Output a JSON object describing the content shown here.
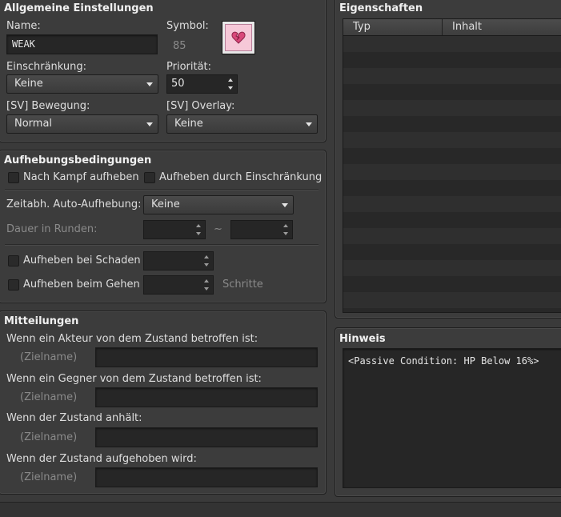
{
  "general": {
    "title": "Allgemeine Einstellungen",
    "name_label": "Name:",
    "name_value": "WEAK",
    "symbol_label": "Symbol:",
    "symbol_index": "85",
    "restriction_label": "Einschränkung:",
    "restriction_value": "Keine",
    "priority_label": "Priorität:",
    "priority_value": "50",
    "sv_motion_label": "[SV] Bewegung:",
    "sv_motion_value": "Normal",
    "sv_overlay_label": "[SV] Overlay:",
    "sv_overlay_value": "Keine",
    "icon_name": "broken-heart-icon",
    "icon_color": "#d9487a"
  },
  "removal": {
    "title": "Aufhebungsbedingungen",
    "remove_after_battle": "Nach Kampf aufheben",
    "remove_by_restriction": "Aufheben durch Einschränkung",
    "auto_removal_label": "Zeitabh. Auto-Aufhebung:",
    "auto_removal_value": "Keine",
    "duration_label": "Dauer in Runden:",
    "duration_sep": "~",
    "remove_by_damage": "Aufheben bei Schaden",
    "remove_by_walking": "Aufheben beim Gehen",
    "steps_label": "Schritte"
  },
  "messages": {
    "title": "Mitteilungen",
    "actor_label": "Wenn ein Akteur von dem Zustand betroffen ist:",
    "enemy_label": "Wenn ein Gegner von dem Zustand betroffen ist:",
    "persist_label": "Wenn der Zustand anhält:",
    "removed_label": "Wenn der Zustand aufgehoben wird:",
    "target_placeholder": "(Zielname)"
  },
  "traits": {
    "title": "Eigenschaften",
    "col_type": "Typ",
    "col_content": "Inhalt"
  },
  "note": {
    "title": "Hinweis",
    "text": "<Passive Condition: HP Below 16%>"
  }
}
